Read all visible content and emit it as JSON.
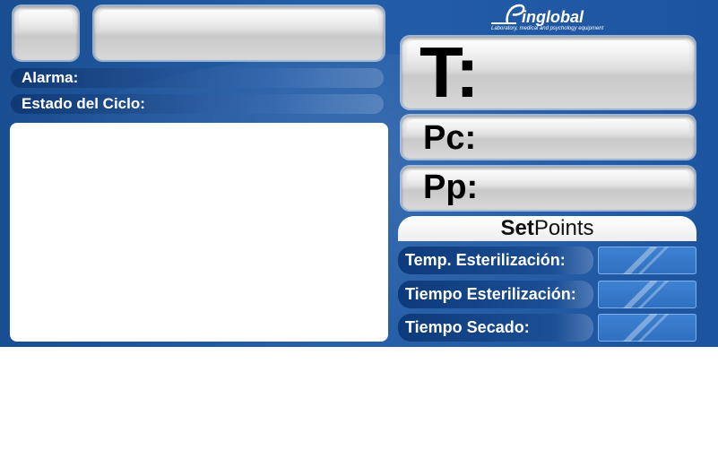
{
  "header": {
    "logo_text": "inglobal",
    "logo_tagline": "Laboratory, medical and psychology equipment"
  },
  "status": {
    "alarm_label": "Alarma:",
    "cycle_label": "Estado del Ciclo:"
  },
  "readouts": {
    "temperature_label": "T:",
    "chamber_pressure_label": "Pc:",
    "jacket_pressure_label": "Pp:"
  },
  "setpoints": {
    "title_bold": "Set",
    "title_rest": "Points",
    "items": [
      {
        "label": "Temp. Esterilización:",
        "value": ""
      },
      {
        "label": "Tiempo Esterilización:",
        "value": ""
      },
      {
        "label": "Tiempo Secado:",
        "value": ""
      }
    ]
  },
  "colors": {
    "panel_blue": "#1f58a2",
    "input_blue": "#3577c8",
    "glass_grey": "#d4d4d4"
  }
}
